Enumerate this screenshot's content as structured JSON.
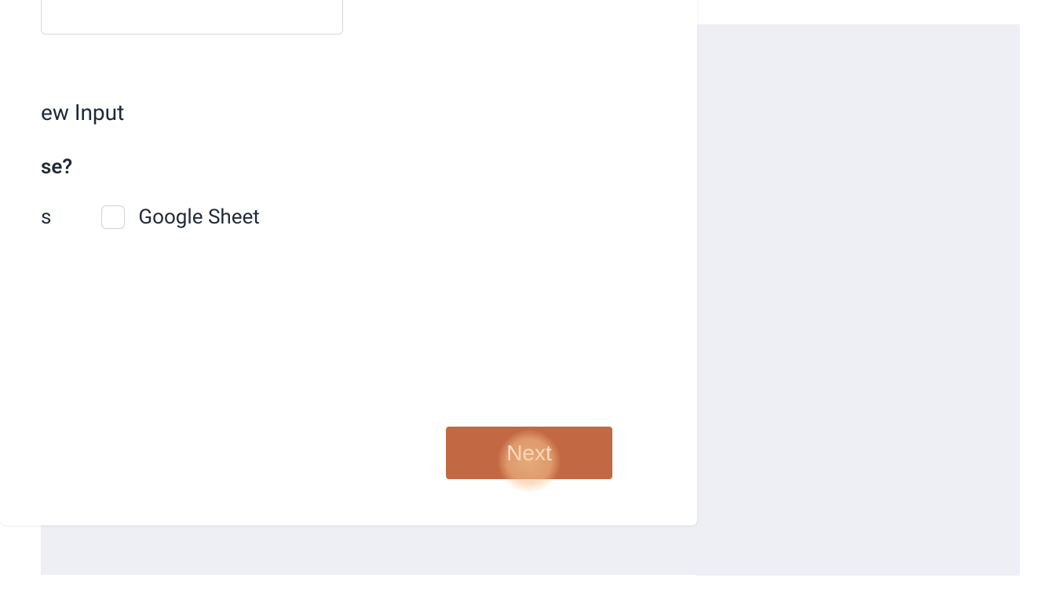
{
  "form": {
    "heading_fragment": "ew Input",
    "question_fragment": "se?",
    "options": {
      "first_fragment": "s",
      "google_sheet_label": "Google Sheet"
    },
    "next_label": "Next"
  }
}
